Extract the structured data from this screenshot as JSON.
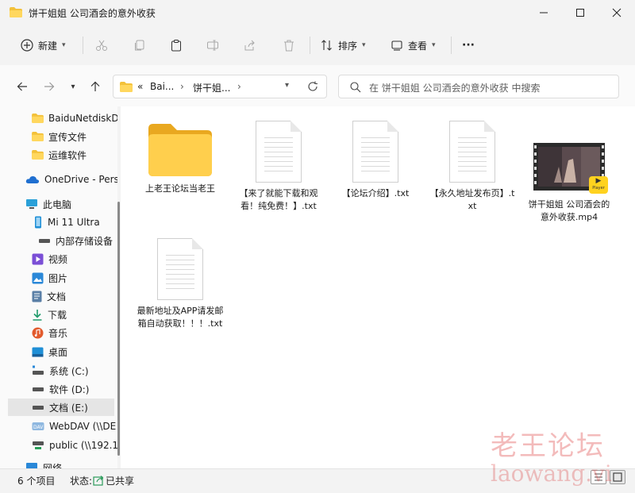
{
  "window": {
    "title": "饼干姐姐 公司酒会的意外收获",
    "minimize_icon": "minimize-icon",
    "maximize_icon": "maximize-icon",
    "close_icon": "close-icon"
  },
  "toolbar": {
    "new_label": "新建",
    "sort_label": "排序",
    "view_label": "查看",
    "more_label": "···"
  },
  "address": {
    "prefix": "«",
    "segments": [
      "Bai...",
      "饼干姐..."
    ],
    "search_placeholder": "在 饼干姐姐 公司酒会的意外收获 中搜索"
  },
  "sidebar": {
    "items": [
      {
        "label": "BaiduNetdiskD",
        "icon": "folder-icon"
      },
      {
        "label": "宣传文件",
        "icon": "folder-icon"
      },
      {
        "label": "运维软件",
        "icon": "folder-icon"
      },
      {
        "label": "OneDrive - Pers",
        "icon": "cloud-icon"
      },
      {
        "label": "此电脑",
        "icon": "computer-icon"
      },
      {
        "label": "Mi 11 Ultra",
        "icon": "phone-icon"
      },
      {
        "label": "内部存储设备",
        "icon": "drive-icon"
      },
      {
        "label": "视频",
        "icon": "video-icon"
      },
      {
        "label": "图片",
        "icon": "picture-icon"
      },
      {
        "label": "文档",
        "icon": "document-icon"
      },
      {
        "label": "下载",
        "icon": "download-icon"
      },
      {
        "label": "音乐",
        "icon": "music-icon"
      },
      {
        "label": "桌面",
        "icon": "desktop-icon"
      },
      {
        "label": "系统 (C:)",
        "icon": "drive-icon"
      },
      {
        "label": "软件 (D:)",
        "icon": "drive-icon"
      },
      {
        "label": "文档 (E:)",
        "icon": "drive-icon"
      },
      {
        "label": "WebDAV (\\\\DE",
        "icon": "webdav-icon"
      },
      {
        "label": "public (\\\\192.1",
        "icon": "network-drive-icon"
      },
      {
        "label": "网络",
        "icon": "network-icon"
      }
    ]
  },
  "files": [
    {
      "name": "上老王论坛当老王",
      "type": "folder"
    },
    {
      "name": "【来了就能下载和观看！纯免费！】.txt",
      "type": "txt"
    },
    {
      "name": "【论坛介绍】.txt",
      "type": "txt"
    },
    {
      "name": "【永久地址发布页】.txt",
      "type": "txt"
    },
    {
      "name": "饼干姐姐 公司酒会的意外收获.mp4",
      "type": "video"
    },
    {
      "name": "最新地址及APP请发邮箱自动获取！！！.txt",
      "type": "txt"
    }
  ],
  "video_badge": "Player",
  "status": {
    "count": "6 个项目",
    "state_label": "状态:",
    "state_value": "已共享"
  },
  "watermark": {
    "line1": "老王论坛",
    "line2": "laowang.vi"
  }
}
